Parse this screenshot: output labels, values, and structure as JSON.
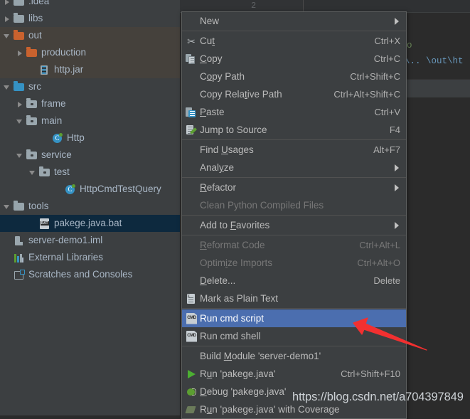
{
  "project_tree": {
    "rows": [
      {
        "label": ".idea",
        "icon": "folder-grey",
        "arrow": "right",
        "indent": 0,
        "shaded": false,
        "selected": false,
        "clipped_top": true
      },
      {
        "label": "libs",
        "icon": "folder-grey",
        "arrow": "right",
        "indent": 0,
        "shaded": false,
        "selected": false
      },
      {
        "label": "out",
        "icon": "folder-orange",
        "arrow": "down",
        "indent": 0,
        "shaded": true,
        "selected": false
      },
      {
        "label": "production",
        "icon": "folder-orange",
        "arrow": "right",
        "indent": 1,
        "shaded": true,
        "selected": false
      },
      {
        "label": "http.jar",
        "icon": "jar",
        "arrow": "none",
        "indent": 2,
        "shaded": true,
        "selected": false
      },
      {
        "label": "src",
        "icon": "folder-blue",
        "arrow": "down",
        "indent": 0,
        "shaded": false,
        "selected": false
      },
      {
        "label": "frame",
        "icon": "folder-pkg",
        "arrow": "right",
        "indent": 1,
        "shaded": false,
        "selected": false
      },
      {
        "label": "main",
        "icon": "folder-pkg",
        "arrow": "down",
        "indent": 1,
        "shaded": false,
        "selected": false
      },
      {
        "label": "Http",
        "icon": "java-class",
        "arrow": "none",
        "indent": 3,
        "shaded": false,
        "selected": false
      },
      {
        "label": "service",
        "icon": "folder-pkg",
        "arrow": "down",
        "indent": 1,
        "shaded": false,
        "selected": false
      },
      {
        "label": "test",
        "icon": "folder-pkg",
        "arrow": "down",
        "indent": 2,
        "shaded": false,
        "selected": false
      },
      {
        "label": "HttpCmdTestQuery",
        "icon": "java-class",
        "arrow": "none",
        "indent": 4,
        "shaded": false,
        "selected": false
      },
      {
        "label": "tools",
        "icon": "folder-grey",
        "arrow": "down",
        "indent": 0,
        "shaded": false,
        "selected": false
      },
      {
        "label": "pakege.java.bat",
        "icon": "bat-file",
        "arrow": "none",
        "indent": 2,
        "shaded": false,
        "selected": true
      },
      {
        "label": "server-demo1.iml",
        "icon": "iml-file",
        "arrow": "none",
        "indent": 0,
        "shaded": false,
        "selected": false
      },
      {
        "label": "External Libraries",
        "icon": "external-libraries",
        "arrow": "none",
        "indent": -1,
        "shaded": false,
        "selected": false
      },
      {
        "label": "Scratches and Consoles",
        "icon": "scratches",
        "arrow": "none",
        "indent": -1,
        "shaded": false,
        "selected": false
      }
    ]
  },
  "editor": {
    "gutter_line_number": "2",
    "code_comment": "o",
    "code_path": "\\.. \\out\\ht"
  },
  "context_menu": {
    "items": [
      {
        "type": "item",
        "label": "New",
        "shortcut": "",
        "icon": "",
        "submenu": true,
        "disabled": false,
        "selected": false
      },
      {
        "type": "sep"
      },
      {
        "type": "item",
        "label": "Cut",
        "shortcut": "Ctrl+X",
        "icon": "cut",
        "submenu": false,
        "disabled": false,
        "selected": false
      },
      {
        "type": "item",
        "label": "Copy",
        "shortcut": "Ctrl+C",
        "icon": "copy",
        "submenu": false,
        "disabled": false,
        "selected": false
      },
      {
        "type": "item",
        "label": "Copy Path",
        "shortcut": "Ctrl+Shift+C",
        "icon": "",
        "submenu": false,
        "disabled": false,
        "selected": false
      },
      {
        "type": "item",
        "label": "Copy Relative Path",
        "shortcut": "Ctrl+Alt+Shift+C",
        "icon": "",
        "submenu": false,
        "disabled": false,
        "selected": false
      },
      {
        "type": "item",
        "label": "Paste",
        "shortcut": "Ctrl+V",
        "icon": "paste",
        "submenu": false,
        "disabled": false,
        "selected": false
      },
      {
        "type": "item",
        "label": "Jump to Source",
        "shortcut": "F4",
        "icon": "jump",
        "submenu": false,
        "disabled": false,
        "selected": false
      },
      {
        "type": "sep"
      },
      {
        "type": "item",
        "label": "Find Usages",
        "shortcut": "Alt+F7",
        "icon": "",
        "submenu": false,
        "disabled": false,
        "selected": false
      },
      {
        "type": "item",
        "label": "Analyze",
        "shortcut": "",
        "icon": "",
        "submenu": true,
        "disabled": false,
        "selected": false
      },
      {
        "type": "sep"
      },
      {
        "type": "item",
        "label": "Refactor",
        "shortcut": "",
        "icon": "",
        "submenu": true,
        "disabled": false,
        "selected": false
      },
      {
        "type": "item",
        "label": "Clean Python Compiled Files",
        "shortcut": "",
        "icon": "",
        "submenu": false,
        "disabled": true,
        "selected": false
      },
      {
        "type": "sep"
      },
      {
        "type": "item",
        "label": "Add to Favorites",
        "shortcut": "",
        "icon": "",
        "submenu": true,
        "disabled": false,
        "selected": false
      },
      {
        "type": "sep"
      },
      {
        "type": "item",
        "label": "Reformat Code",
        "shortcut": "Ctrl+Alt+L",
        "icon": "",
        "submenu": false,
        "disabled": true,
        "selected": false
      },
      {
        "type": "item",
        "label": "Optimize Imports",
        "shortcut": "Ctrl+Alt+O",
        "icon": "",
        "submenu": false,
        "disabled": true,
        "selected": false
      },
      {
        "type": "item",
        "label": "Delete...",
        "shortcut": "Delete",
        "icon": "",
        "submenu": false,
        "disabled": false,
        "selected": false
      },
      {
        "type": "item",
        "label": "Mark as Plain Text",
        "shortcut": "",
        "icon": "plain",
        "submenu": false,
        "disabled": false,
        "selected": false
      },
      {
        "type": "sep"
      },
      {
        "type": "item",
        "label": "Run cmd script",
        "shortcut": "",
        "icon": "cmd",
        "submenu": false,
        "disabled": false,
        "selected": true
      },
      {
        "type": "item",
        "label": "Run cmd shell",
        "shortcut": "",
        "icon": "cmd",
        "submenu": false,
        "disabled": false,
        "selected": false
      },
      {
        "type": "sep"
      },
      {
        "type": "item",
        "label": "Build Module 'server-demo1'",
        "shortcut": "",
        "icon": "",
        "submenu": false,
        "disabled": false,
        "selected": false
      },
      {
        "type": "item",
        "label": "Run 'pakege.java'",
        "shortcut": "Ctrl+Shift+F10",
        "icon": "run",
        "submenu": false,
        "disabled": false,
        "selected": false
      },
      {
        "type": "item",
        "label": "Debug 'pakege.java'",
        "shortcut": "",
        "icon": "debug",
        "submenu": false,
        "disabled": false,
        "selected": false
      },
      {
        "type": "item",
        "label": "Run 'pakege.java' with Coverage",
        "shortcut": "",
        "icon": "coverage",
        "submenu": false,
        "disabled": false,
        "selected": false
      }
    ]
  },
  "annotation": {
    "arrow_color": "#f23030",
    "arrow_target": "Run cmd script"
  },
  "watermark": {
    "text": "https://blog.csdn.net/a704397849"
  },
  "colors": {
    "panel_bg": "#3c3f41",
    "editor_bg": "#2b2b2b",
    "tree_text": "#a9b7c6",
    "selection_navy": "#0d293e",
    "menu_highlight": "#4b6eaf",
    "folder_orange": "#c9622e",
    "folder_blue": "#3592c4",
    "folder_grey": "#96a4ab"
  }
}
